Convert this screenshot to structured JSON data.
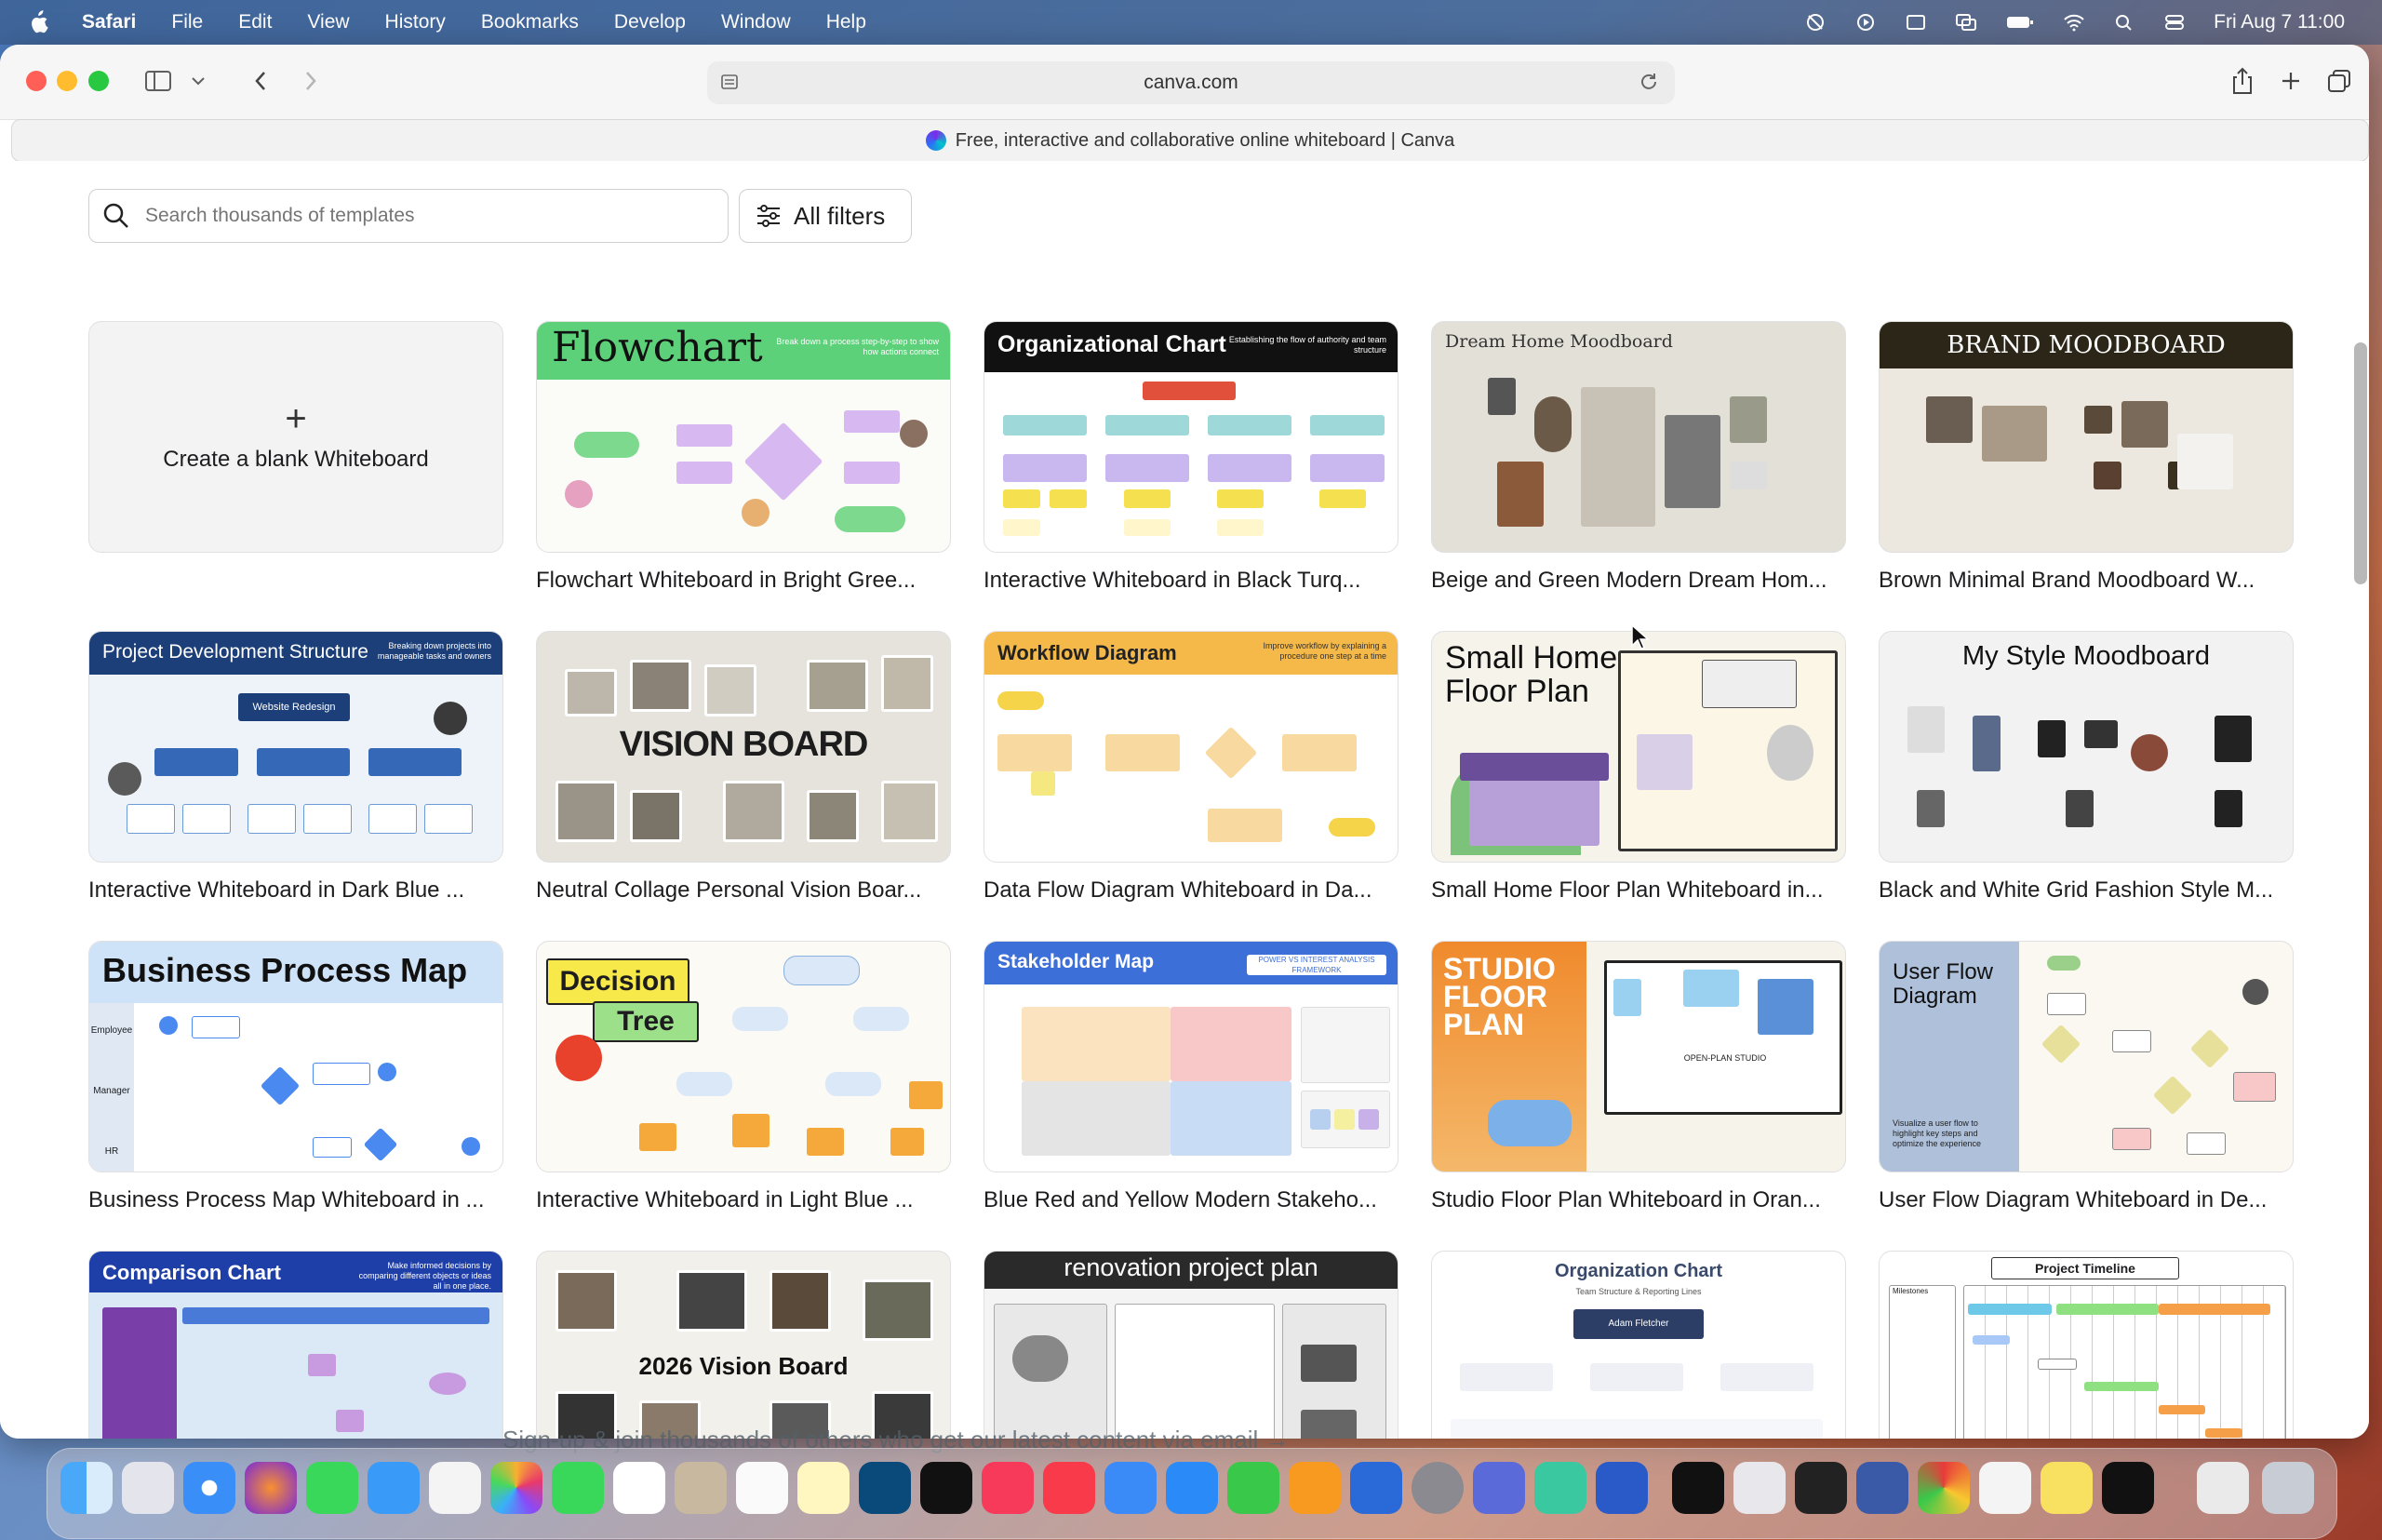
{
  "menubar": {
    "app": "Safari",
    "items": [
      "File",
      "Edit",
      "View",
      "History",
      "Bookmarks",
      "Develop",
      "Window",
      "Help"
    ],
    "clock": "Fri Aug 7  11:00"
  },
  "browser": {
    "url": "canva.com",
    "tab_title": "Free, interactive and collaborative online whiteboard | Canva"
  },
  "search": {
    "placeholder": "Search thousands of templates"
  },
  "filters_label": "All filters",
  "blank_label": "Create a blank Whiteboard",
  "templates": [
    {
      "title": "Flowchart Whiteboard in Bright Gree...",
      "heading": "Flowchart",
      "sub": "Break down a process step-by-step to show how actions connect"
    },
    {
      "title": "Interactive Whiteboard in Black Turq...",
      "heading": "Organizational Chart",
      "sub": "Establishing the flow of authority and team structure"
    },
    {
      "title": "Beige and Green Modern Dream Hom...",
      "heading": "Dream Home Moodboard"
    },
    {
      "title": "Brown Minimal Brand Moodboard W...",
      "heading": "BRAND MOODBOARD"
    },
    {
      "title": "Interactive Whiteboard in Dark Blue ...",
      "heading": "Project Development Structure",
      "sub": "Breaking down projects into manageable tasks and owners",
      "node": "Website Redesign"
    },
    {
      "title": "Neutral Collage Personal Vision Boar...",
      "heading": "VISION BOARD"
    },
    {
      "title": "Data Flow Diagram Whiteboard in Da...",
      "heading": "Workflow Diagram",
      "sub": "Improve workflow by explaining a procedure one step at a time"
    },
    {
      "title": "Small Home Floor Plan Whiteboard in...",
      "heading": "Small Home Floor Plan"
    },
    {
      "title": "Black and White Grid Fashion Style M...",
      "heading": "My Style Moodboard"
    },
    {
      "title": "Business Process Map Whiteboard in ...",
      "heading": "Business Process Map",
      "lanes": [
        "Employee",
        "Manager",
        "HR"
      ]
    },
    {
      "title": "Interactive Whiteboard in Light Blue ...",
      "heading": "Decision",
      "heading2": "Tree"
    },
    {
      "title": "Blue Red and Yellow Modern Stakeho...",
      "heading": "Stakeholder Map",
      "sub": "POWER VS INTEREST ANALYSIS FRAMEWORK"
    },
    {
      "title": "Studio Floor Plan Whiteboard in Oran...",
      "heading": "STUDIO FLOOR PLAN",
      "sub": "OPEN-PLAN STUDIO"
    },
    {
      "title": "User Flow Diagram Whiteboard in De...",
      "heading": "User Flow Diagram",
      "sub": "Visualize a user flow to highlight key steps and optimize the experience"
    },
    {
      "title": "",
      "heading": "Comparison Chart",
      "sub": "Make informed decisions by comparing different objects or ideas all in one place."
    },
    {
      "title": "",
      "heading": "2026 Vision Board"
    },
    {
      "title": "",
      "heading": "renovation project plan"
    },
    {
      "title": "",
      "heading": "Organization Chart",
      "sub": "Team Structure & Reporting Lines",
      "node": "Adam Fletcher"
    },
    {
      "title": "",
      "heading": "Project Timeline",
      "sub": "Milestones"
    }
  ],
  "bottom_text": "Sign-up & join thousands of others who get our latest content via email →"
}
